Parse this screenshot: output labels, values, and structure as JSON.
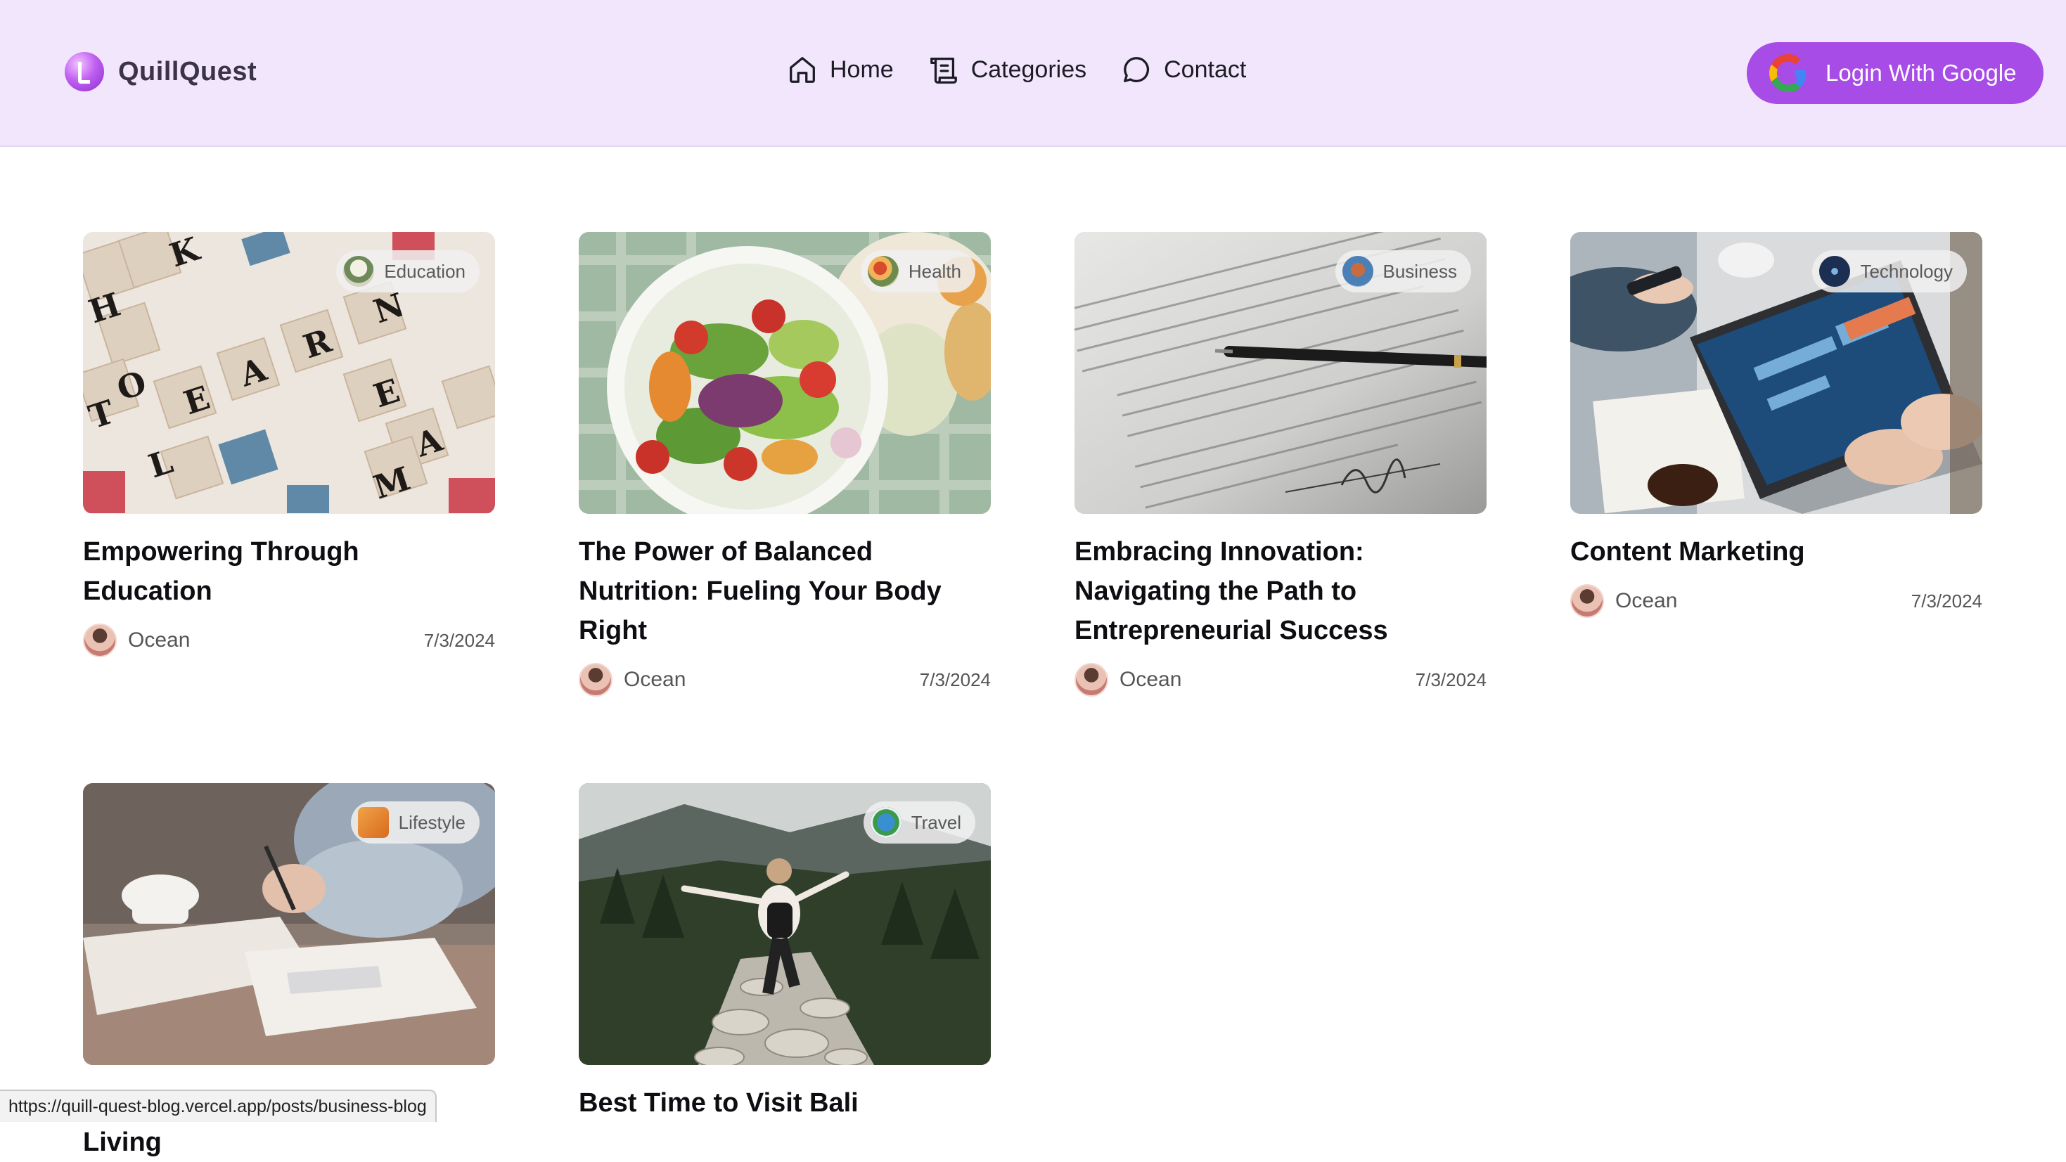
{
  "app": {
    "brand": "QuillQuest"
  },
  "nav": {
    "items": [
      {
        "label": "Home",
        "icon": "home-icon"
      },
      {
        "label": "Categories",
        "icon": "scroll-icon"
      },
      {
        "label": "Contact",
        "icon": "chat-bubble-icon"
      }
    ]
  },
  "auth": {
    "login_label": "Login With Google",
    "icon": "google-icon"
  },
  "posts": [
    {
      "title": "Empowering Through Education",
      "category": "Education",
      "author": "Ocean",
      "date": "7/3/2024"
    },
    {
      "title": "The Power of Balanced Nutrition: Fueling Your Body Right",
      "category": "Health",
      "author": "Ocean",
      "date": "7/3/2024"
    },
    {
      "title": "Embracing Innovation: Navigating the Path to Entrepreneurial Success",
      "category": "Business",
      "author": "Ocean",
      "date": "7/3/2024"
    },
    {
      "title": "Content Marketing",
      "category": "Technology",
      "author": "Ocean",
      "date": "7/3/2024"
    },
    {
      "title": "Exploring the Joys of Slow Living",
      "category": "Lifestyle",
      "author": "",
      "date": ""
    },
    {
      "title": "Best Time to Visit Bali",
      "category": "Travel",
      "author": "",
      "date": ""
    }
  ],
  "status_bar": {
    "url": "https://quill-quest-blog.vercel.app/posts/business-blog"
  },
  "colors": {
    "header_bg": "#f1e6fc",
    "accent": "#a74ce6"
  }
}
